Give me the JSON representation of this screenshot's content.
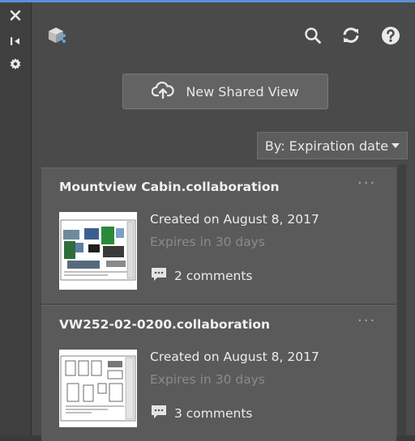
{
  "toolbar": {
    "new_shared_view_label": "New Shared View",
    "sort_label": "By: Expiration date"
  },
  "cards": [
    {
      "title": "Mountview Cabin.collaboration",
      "created": "Created on August 8, 2017",
      "expires": "Expires in 30 days",
      "comments": "2 comments",
      "more": "···"
    },
    {
      "title": "VW252-02-0200.collaboration",
      "created": "Created on August 8, 2017",
      "expires": "Expires in 30 days",
      "comments": "3 comments",
      "more": "···"
    }
  ],
  "icons": [
    "close-icon",
    "collapse-icon",
    "settings-icon",
    "cube-share-icon",
    "search-icon",
    "refresh-icon",
    "help-icon",
    "cloud-upload-icon",
    "comment-icon",
    "more-icon"
  ],
  "colors": {
    "accent": "#5b8fd9",
    "panel": "#4a4a4a",
    "card": "#5a5a5a"
  }
}
